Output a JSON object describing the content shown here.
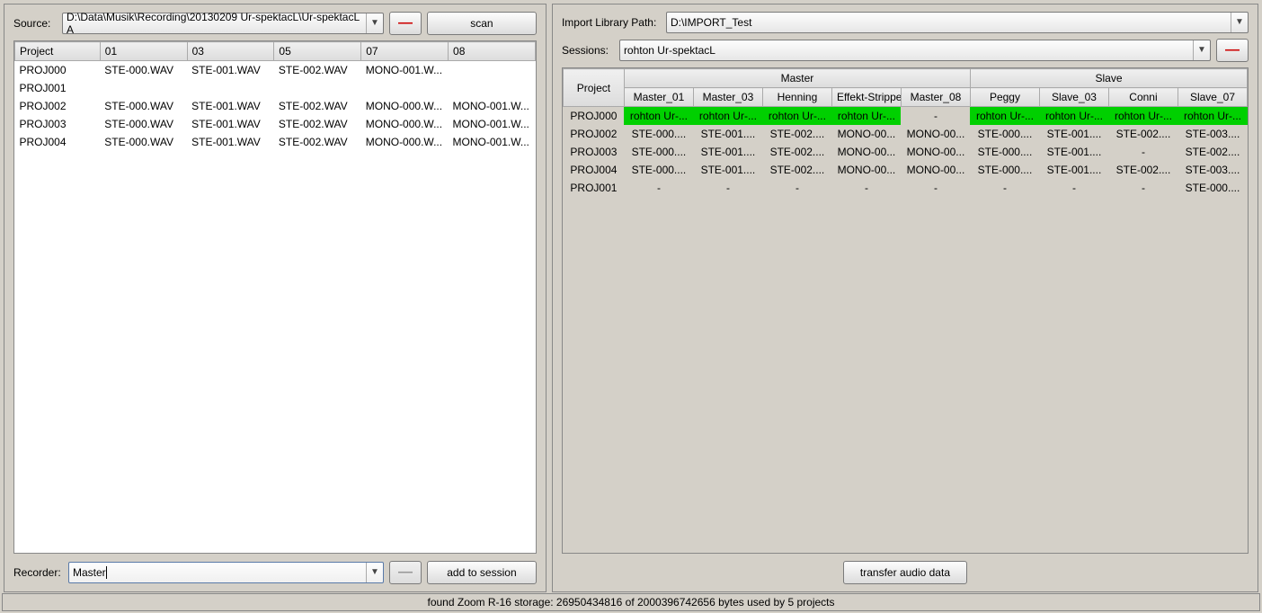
{
  "left": {
    "source_label": "Source:",
    "source_path": "D:\\Data\\Musik\\Recording\\20130209 Ur-spektacL\\Ur-spektacL A",
    "scan_label": "scan",
    "columns": [
      "Project",
      "01",
      "03",
      "05",
      "07",
      "08"
    ],
    "rows": [
      [
        "PROJ000",
        "STE-000.WAV",
        "STE-001.WAV",
        "STE-002.WAV",
        "MONO-001.W...",
        ""
      ],
      [
        "PROJ001",
        "",
        "",
        "",
        "",
        ""
      ],
      [
        "PROJ002",
        "STE-000.WAV",
        "STE-001.WAV",
        "STE-002.WAV",
        "MONO-000.W...",
        "MONO-001.W..."
      ],
      [
        "PROJ003",
        "STE-000.WAV",
        "STE-001.WAV",
        "STE-002.WAV",
        "MONO-000.W...",
        "MONO-001.W..."
      ],
      [
        "PROJ004",
        "STE-000.WAV",
        "STE-001.WAV",
        "STE-002.WAV",
        "MONO-000.W...",
        "MONO-001.W..."
      ]
    ],
    "recorder_label": "Recorder:",
    "recorder_value": "Master",
    "add_label": "add to session"
  },
  "right": {
    "import_label": "Import Library Path:",
    "import_path": "D:\\IMPORT_Test",
    "sessions_label": "Sessions:",
    "session_value": "rohton Ur-spektacL",
    "group_headers": {
      "project": "Project",
      "master": "Master",
      "slave": "Slave"
    },
    "track_headers": [
      "Master_01",
      "Master_03",
      "Henning",
      "Effekt-Strippe",
      "Master_08",
      "Peggy",
      "Slave_03",
      "Conni",
      "Slave_07"
    ],
    "rows": [
      {
        "proj": "PROJ000",
        "green": [
          true,
          true,
          true,
          true,
          false,
          true,
          true,
          true,
          true
        ],
        "cells": [
          "rohton Ur-...",
          "rohton Ur-...",
          "rohton Ur-...",
          "rohton Ur-...",
          "-",
          "rohton Ur-...",
          "rohton Ur-...",
          "rohton Ur-...",
          "rohton Ur-..."
        ]
      },
      {
        "proj": "PROJ002",
        "green": [
          false,
          false,
          false,
          false,
          false,
          false,
          false,
          false,
          false
        ],
        "cells": [
          "STE-000....",
          "STE-001....",
          "STE-002....",
          "MONO-00...",
          "MONO-00...",
          "STE-000....",
          "STE-001....",
          "STE-002....",
          "STE-003...."
        ]
      },
      {
        "proj": "PROJ003",
        "green": [
          false,
          false,
          false,
          false,
          false,
          false,
          false,
          false,
          false
        ],
        "cells": [
          "STE-000....",
          "STE-001....",
          "STE-002....",
          "MONO-00...",
          "MONO-00...",
          "STE-000....",
          "STE-001....",
          "-",
          "STE-002...."
        ]
      },
      {
        "proj": "PROJ004",
        "green": [
          false,
          false,
          false,
          false,
          false,
          false,
          false,
          false,
          false
        ],
        "cells": [
          "STE-000....",
          "STE-001....",
          "STE-002....",
          "MONO-00...",
          "MONO-00...",
          "STE-000....",
          "STE-001....",
          "STE-002....",
          "STE-003...."
        ]
      },
      {
        "proj": "PROJ001",
        "green": [
          false,
          false,
          false,
          false,
          false,
          false,
          false,
          false,
          false
        ],
        "cells": [
          "-",
          "-",
          "-",
          "-",
          "-",
          "-",
          "-",
          "-",
          "STE-000...."
        ]
      }
    ],
    "transfer_label": "transfer audio data"
  },
  "status": "found Zoom R-16 storage: 26950434816 of 2000396742656 bytes used by 5 projects"
}
